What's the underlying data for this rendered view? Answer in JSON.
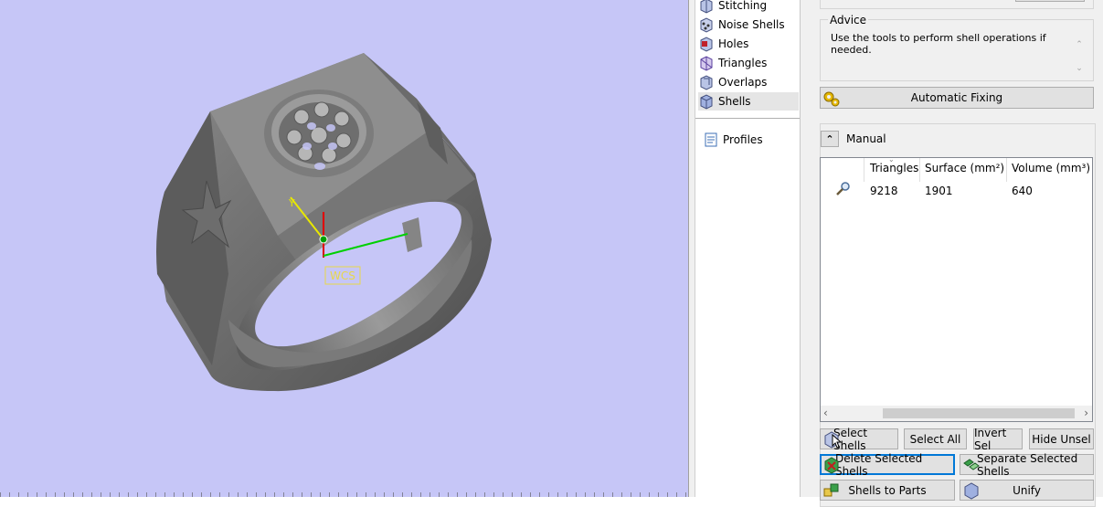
{
  "viewport": {
    "wcs_label": "WCS",
    "axis_x_label": "Y"
  },
  "tree": {
    "items": [
      {
        "label": "Stitching",
        "icon": "stitching-icon"
      },
      {
        "label": "Noise Shells",
        "icon": "noise-shells-icon"
      },
      {
        "label": "Holes",
        "icon": "holes-icon"
      },
      {
        "label": "Triangles",
        "icon": "triangles-icon"
      },
      {
        "label": "Overlaps",
        "icon": "overlaps-icon"
      },
      {
        "label": "Shells",
        "icon": "shells-icon",
        "selected": true
      }
    ],
    "profiles": "Profiles"
  },
  "advice": {
    "title": "Advice",
    "text": "Use the tools to perform shell operations if needed."
  },
  "automatic_fixing": "Automatic Fixing",
  "manual": {
    "label": "Manual",
    "columns": [
      "Triangles",
      "Surface (mm²)",
      "Volume (mm³)"
    ],
    "rows": [
      {
        "triangles": "9218",
        "surface": "1901",
        "volume": "640"
      }
    ]
  },
  "buttons": {
    "select_shells": "Select Shells",
    "select_all": "Select All",
    "invert_sel": "Invert Sel",
    "hide_unsel": "Hide Unsel",
    "delete_selected": "Delete Selected Shells",
    "separate_selected": "Separate Selected Shells",
    "shells_to_parts": "Shells to Parts",
    "unify": "Unify"
  }
}
